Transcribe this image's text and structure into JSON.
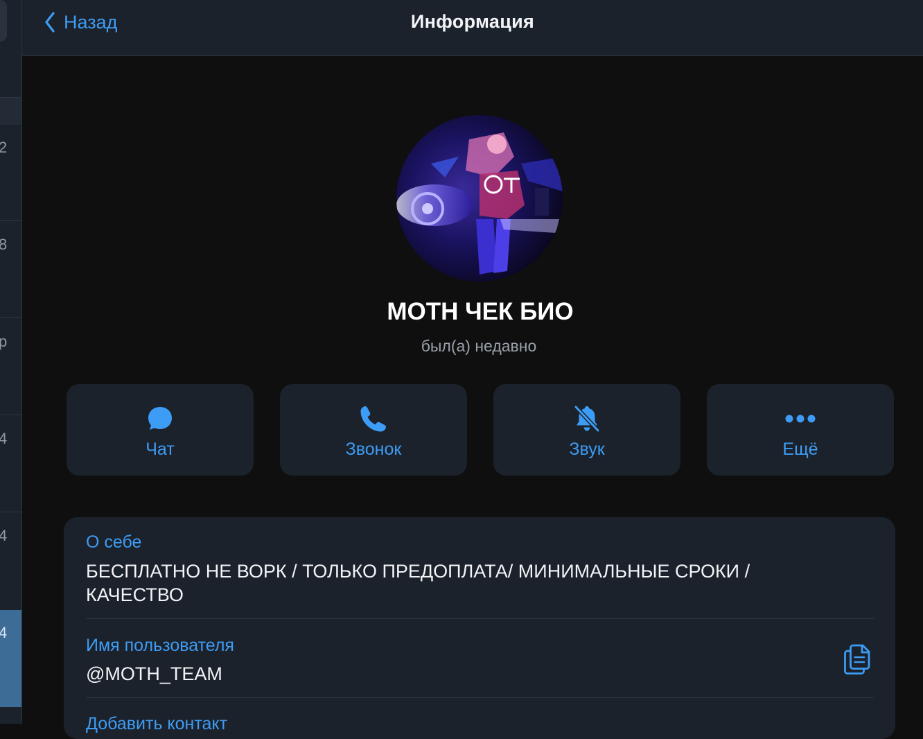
{
  "header": {
    "back_label": "Назад",
    "title": "Информация"
  },
  "left_list": {
    "visible_digits": [
      "2",
      "8",
      "р",
      "4",
      "4",
      "4"
    ]
  },
  "profile": {
    "name": "MOTH ЧЕК БИО",
    "status": "был(а) недавно",
    "avatar_icon": "avatar-image"
  },
  "actions": [
    {
      "label": "Чат",
      "icon": "chat-bubble-icon"
    },
    {
      "label": "Звонок",
      "icon": "phone-icon"
    },
    {
      "label": "Звук",
      "icon": "bell-muted-icon"
    },
    {
      "label": "Ещё",
      "icon": "more-dots-icon"
    }
  ],
  "info": {
    "bio_label": "О себе",
    "bio_value": "БЕСПЛАТНО НЕ ВОРК / ТОЛЬКО ПРЕДОПЛАТА/ МИНИМАЛЬНЫЕ СРОКИ / КАЧЕСТВО",
    "username_label": "Имя пользователя",
    "username_value": "@MOTH_TEAM",
    "add_contact_label": "Добавить контакт"
  },
  "colors": {
    "accent": "#3d9cf5",
    "panel": "#1c222b",
    "background": "#0f0f10",
    "selected_row": "#3d6c97"
  }
}
